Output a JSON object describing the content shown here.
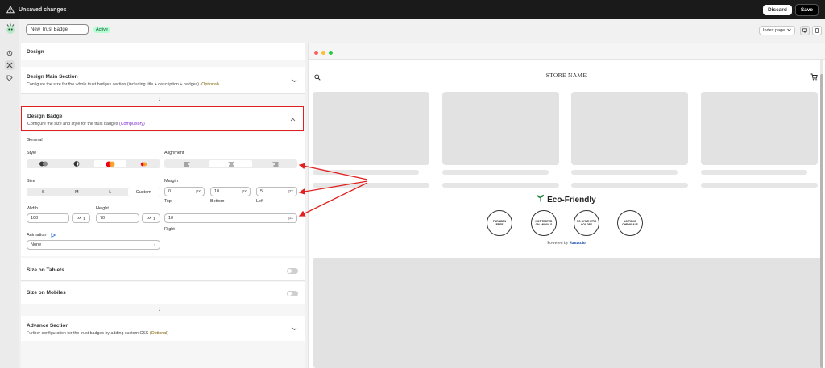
{
  "topbar": {
    "title": "Unsaved changes",
    "discard": "Discard",
    "save": "Save"
  },
  "header": {
    "badge_name": "New Trust Badge",
    "status": "Active",
    "page_select": "Index page"
  },
  "sections": {
    "design": "Design",
    "main": {
      "title": "Design Main Section",
      "desc": "Configure the size for the whole trust badges section (including title + description + badges)",
      "tag": "(Optional)"
    },
    "badge": {
      "title": "Design Badge",
      "desc": "Configure the size and style for the trust badges",
      "tag": "(Compulsory)"
    },
    "tablets": "Size on Tablets",
    "mobiles": "Size on Mobiles",
    "advance": {
      "title": "Advance Section",
      "desc": "Further configuration for the trust badges by adding custom CSS",
      "tag": "(Optional)"
    }
  },
  "design_badge": {
    "general": "General",
    "style_label": "Style",
    "alignment_label": "Alignment",
    "size_label": "Size",
    "sizes": [
      "S",
      "M",
      "L",
      "Custom"
    ],
    "margin_label": "Margin",
    "margin": {
      "top": "0",
      "bottom": "10",
      "left": "5",
      "right": "10",
      "unit": "px",
      "top_label": "Top",
      "bottom_label": "Bottom",
      "left_label": "Left",
      "right_label": "Right"
    },
    "width_label": "Width",
    "width": "100",
    "width_unit": "px",
    "height_label": "Height",
    "height": "70",
    "height_unit": "px",
    "animation_label": "Animation",
    "animation": "None"
  },
  "preview": {
    "store_name": "STORE NAME",
    "heading": "Eco-Friendly",
    "badges": [
      [
        "PARABEN",
        "FREE"
      ],
      [
        "NOT TESTED",
        "ON ANIMALS"
      ],
      [
        "NO SYNTHETIC",
        "COLORS"
      ],
      [
        "NO TOXIC",
        "CHEMICALS"
      ]
    ],
    "powered_prefix": "Powered by",
    "powered_link": "Sanzu.io"
  },
  "colors": {
    "accent_red": "#e0201e",
    "active_green": "#b4fed2",
    "compulsory": "#7b2fd1",
    "optional": "#7a5e00"
  }
}
